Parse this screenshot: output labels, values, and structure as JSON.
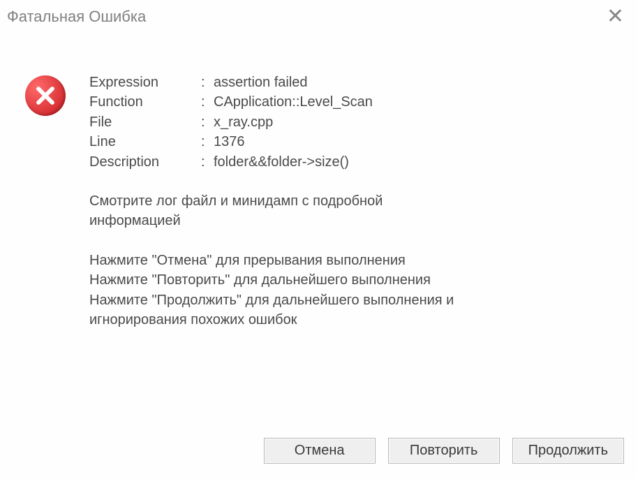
{
  "title": "Фатальная Ошибка",
  "fields": {
    "expression": {
      "label": "Expression",
      "sep": ":",
      "value": "assertion failed"
    },
    "function": {
      "label": "Function",
      "sep": ":",
      "value": "CApplication::Level_Scan"
    },
    "file": {
      "label": "File",
      "sep": ":",
      "value": "x_ray.cpp"
    },
    "line": {
      "label": "Line",
      "sep": ":",
      "value": "1376"
    },
    "description": {
      "label": "Description",
      "sep": ":",
      "value": "folder&&folder->size()"
    }
  },
  "hint1_a": "Смотрите лог файл и минидамп с подробной",
  "hint1_b": "информацией",
  "hint2_a": "Нажмите \"Отмена\" для прерывания выполнения",
  "hint2_b": "Нажмите \"Повторить\" для дальнейшего выполнения",
  "hint2_c": "Нажмите \"Продолжить\" для дальнейшего выполнения и",
  "hint2_d": "игнорирования похожих ошибок",
  "buttons": {
    "cancel": "Отмена",
    "retry": "Повторить",
    "continue": "Продолжить"
  }
}
